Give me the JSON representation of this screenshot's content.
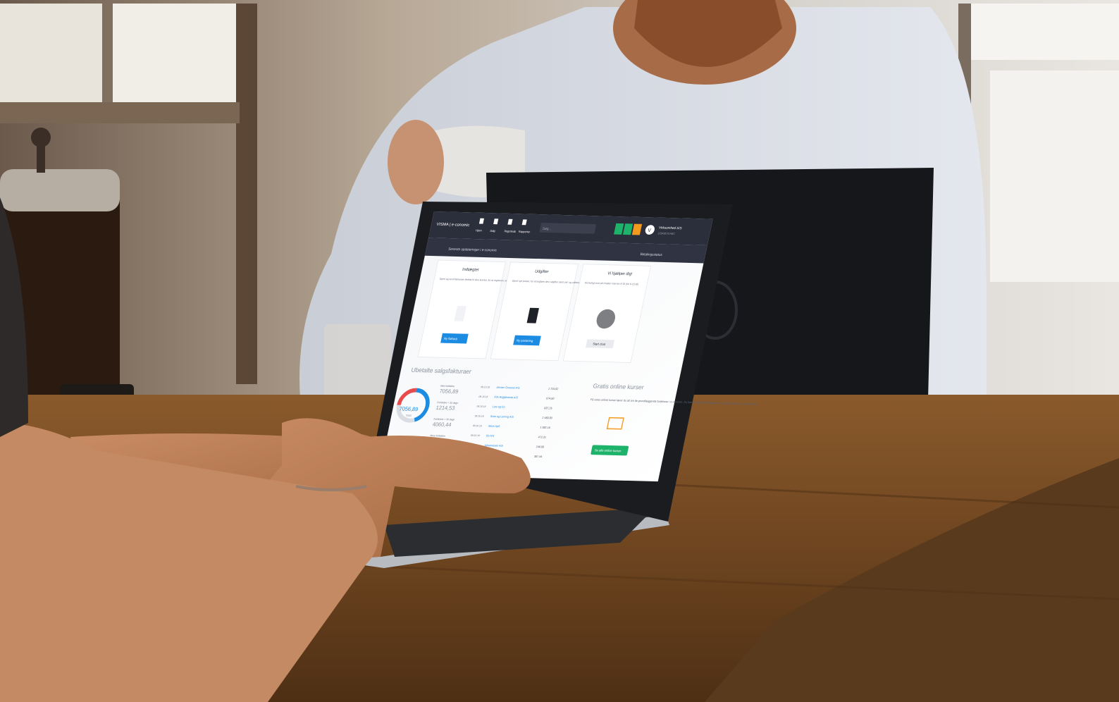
{
  "scene": {
    "description_tag": "cafe-laptop-photo"
  },
  "app": {
    "logo_text": "VISMA | e-conomic",
    "nav": [
      {
        "label": "Hjem",
        "icon": "home-icon"
      },
      {
        "label": "Salg",
        "icon": "dollar-icon"
      },
      {
        "label": "Regnskab",
        "icon": "ledger-icon"
      },
      {
        "label": "Rapporter",
        "icon": "chart-icon"
      }
    ],
    "search_placeholder": "Søg...",
    "company_name": "Virksomhed A/S",
    "company_sub": "12345678 ABC",
    "avatar_letter": "V",
    "subbar_left": "Seneste opdateringer i e-conomic",
    "subbar_right": "Betalingsstatus"
  },
  "cards": [
    {
      "title": "Indtægter",
      "text": "Opret og send fakturaer direkte til dine kunder, for at registrere salg",
      "button": "Ny faktura"
    },
    {
      "title": "Udgifter",
      "text": "Opret nye poster, for at bogføre dine udgifter samt ind- og udbetalinger",
      "button": "Ny postering"
    },
    {
      "title": "Vi hjælper dig!",
      "text": "Få hurtigt svar på chatten man-tor 9-16 (fre 9-15:30)",
      "button": "Start chat"
    }
  ],
  "invoices": {
    "title": "Ubetalte salgsfakturaer",
    "total_value": "7056,89",
    "total_label": "Total",
    "stats": [
      {
        "label": "Ikke forfaldne",
        "value": "7056,89"
      },
      {
        "label": "Forfaldne < 30 dage",
        "value": "1214,53"
      },
      {
        "label": "Forfaldne > 30 dage",
        "value": "4060,44"
      },
      {
        "label": "Mere forfaldne",
        "value": "1871,3"
      }
    ],
    "rows": [
      {
        "date": "08.10.18",
        "name": "Jensen Grossist A/S",
        "amount": "1 724,62"
      },
      {
        "date": "08.10.18",
        "name": "Kirk Bogtjeneste A/S",
        "amount": "574,50"
      },
      {
        "date": "08.10.18",
        "name": "Lars og Co",
        "amount": "837,25"
      },
      {
        "date": "08.10.18",
        "name": "Sven og Lemvig A/S",
        "amount": "2 450,00"
      },
      {
        "date": "08.10.18",
        "name": "Store ApS",
        "amount": "1 082,18"
      },
      {
        "date": "08.10.18",
        "name": "Bo A/S",
        "amount": "472,31"
      },
      {
        "date": "08.10.18",
        "name": "Johannesen A/S",
        "amount": "248,00"
      },
      {
        "date": "",
        "name": "",
        "amount": "387,44"
      }
    ]
  },
  "courses": {
    "title": "Gratis online kurser",
    "text": "På vores online kurser lærer du alt om de grundlæggende funktioner i e-conomic. Du kan også tilbyde fortløbende vedligeholdelse og anvendelser.",
    "button": "Se alle online kurser"
  },
  "donut": {
    "segments": [
      0.45,
      0.3,
      0.25
    ]
  },
  "colors": {
    "nav_bg": "#2b2e3b",
    "accent_blue": "#1c8ce3",
    "accent_green": "#1db36a",
    "accent_orange": "#f49a1c",
    "donut_red": "#e84b4b",
    "donut_grey": "#dadde2",
    "table_wood": "#6e4520"
  }
}
